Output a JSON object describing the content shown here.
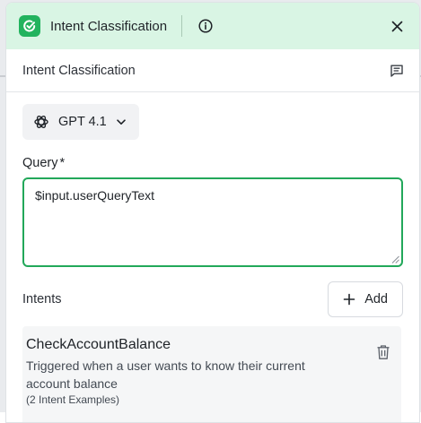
{
  "header": {
    "title": "Intent Classification",
    "icons": {
      "logo": "app-logo-icon",
      "info": "info-icon",
      "close": "close-icon"
    }
  },
  "subheader": {
    "title": "Intent Classification",
    "icon": "notes-icon"
  },
  "model": {
    "label": "GPT 4.1",
    "icon": "openai-icon",
    "chevron": "chevron-down-icon"
  },
  "query": {
    "label": "Query",
    "required_mark": "*",
    "value": "$input.userQueryText"
  },
  "intents": {
    "label": "Intents",
    "add_label": "Add",
    "items": [
      {
        "name": "CheckAccountBalance",
        "description": "Triggered when a user wants to know their current account balance",
        "examples": "(2 Intent Examples)"
      }
    ]
  },
  "colors": {
    "accent": "#22b35e",
    "header_bg": "#d9f5e4",
    "focus_border": "#22a85a"
  }
}
